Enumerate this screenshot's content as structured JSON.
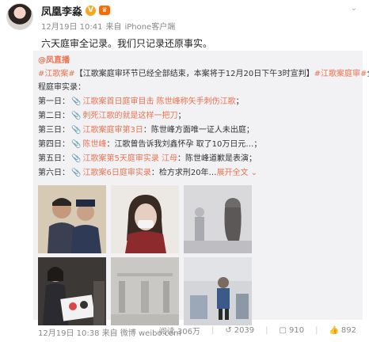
{
  "author": {
    "name": "凤凰李淼",
    "badge_v": "V",
    "badge_rank": "♛"
  },
  "post": {
    "time": "12月19日 10:41",
    "source_prefix": "来自",
    "source": "iPhone客户端",
    "text": "六天庭审全记录。我们只记录还原事实。"
  },
  "repost": {
    "author": "@凤直播",
    "line1_tag": "#江歌案#",
    "line1_text": "【江歌案庭审环节已经全部结束，本案将于12月20日下午3时宣判】",
    "line1_tag2": "#江歌案庭审#",
    "line1_tail": "全",
    "line2": "程庭审实录：",
    "days": [
      {
        "label": "第一日：",
        "link": "江歌案首日庭审目击 陈世峰称矢手刺伤江歌",
        "tail": "；"
      },
      {
        "label": "第二日：",
        "link": "刺死江歌的就是这样一把刀",
        "tail": "；"
      },
      {
        "label": "第三日：",
        "link": "江歌案庭审第3日",
        "tail": "：陈世峰方面唯一证人未出庭；"
      },
      {
        "label": "第四日：",
        "link": "陈世峰",
        "tail": "：江歌曾告诉我刘鑫怀孕 取了10万日元…；"
      },
      {
        "label": "第五日：",
        "link": "江歌案第5天庭审实录 江母",
        "tail": "：陈世峰道歉是表演；"
      },
      {
        "label": "第六日：",
        "link": "江歌案6日庭审实录",
        "tail": "：检方求刑20年…",
        "full": "展开全文 ⌄"
      }
    ]
  },
  "footer": {
    "time": "12月19日 10:38 来自 微博 weibo.com",
    "reads": "阅读 306万",
    "reposts": "2039",
    "comments": "910",
    "likes": "892"
  },
  "colors": {
    "accent": "#eb7350",
    "repost_bg": "#f2f2f5"
  }
}
